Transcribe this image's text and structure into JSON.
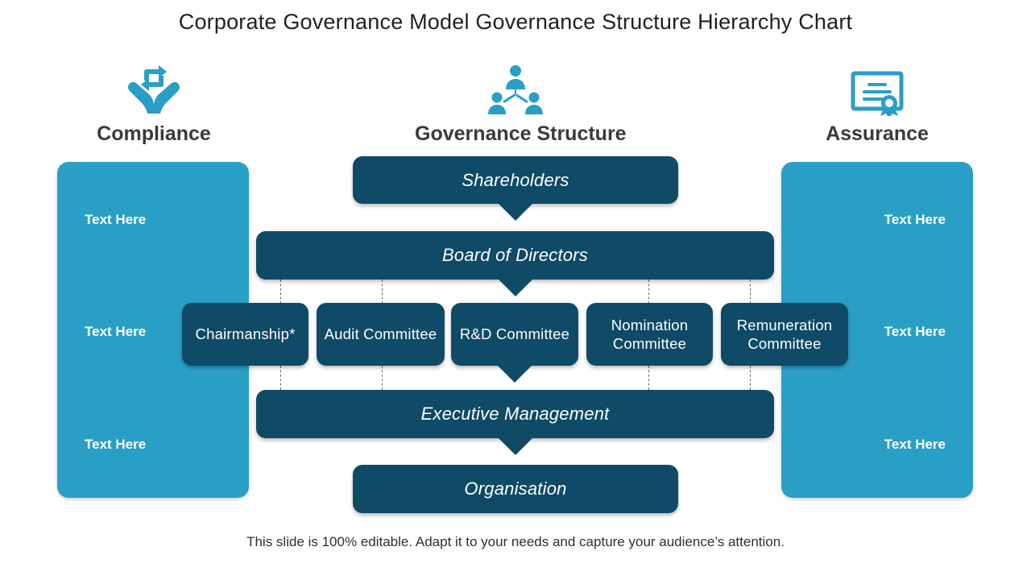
{
  "title": "Corporate Governance Model Governance Structure Hierarchy Chart",
  "footer": "This slide is 100% editable. Adapt it to your needs and capture your audience’s attention.",
  "colors": {
    "dark_box": "#0f4a66",
    "panel_blue": "#2a9fc6",
    "icon_blue": "#2a9fc6",
    "title_text": "#231f20",
    "heading_text": "#3a3a3a",
    "box_text": "#ffffff",
    "dash_line": "#6b6b6b",
    "background": "#ffffff"
  },
  "columns": {
    "left": {
      "label": "Compliance",
      "icon": "hands-holding-recycle-arrows-icon"
    },
    "center": {
      "label": "Governance Structure",
      "icon": "org-people-hierarchy-icon"
    },
    "right": {
      "label": "Assurance",
      "icon": "certificate-award-icon"
    }
  },
  "left_panel": {
    "name": "compliance-panel",
    "items": [
      "Text Here",
      "Text Here",
      "Text Here"
    ]
  },
  "right_panel": {
    "name": "assurance-panel",
    "items": [
      "Text Here",
      "Text Here",
      "Text Here"
    ]
  },
  "chart_data": {
    "type": "diagram",
    "title": "Governance Structure",
    "levels": [
      {
        "id": "shareholders",
        "label": "Shareholders",
        "rank": 1
      },
      {
        "id": "board",
        "label": "Board of Directors",
        "rank": 2
      },
      {
        "id": "committees",
        "label": "Committees",
        "rank": 3
      },
      {
        "id": "executive",
        "label": "Executive Management",
        "rank": 4
      },
      {
        "id": "organisation",
        "label": "Organisation",
        "rank": 5
      }
    ],
    "committees": [
      "Chairmanship*",
      "Audit Committee",
      "R&D Committee",
      "Nomination Committee",
      "Remuneration Committee"
    ],
    "edges": [
      {
        "from": "shareholders",
        "to": "board",
        "style": "arrow"
      },
      {
        "from": "board",
        "to": "committees",
        "style": "dashed"
      },
      {
        "from": "board",
        "to": "executive",
        "style": "arrow"
      },
      {
        "from": "committees",
        "to": "executive",
        "style": "dashed"
      },
      {
        "from": "executive",
        "to": "organisation",
        "style": "arrow"
      }
    ]
  },
  "flow": {
    "shareholders": "Shareholders",
    "board": "Board of Directors",
    "executive": "Executive Management",
    "organisation": "Organisation"
  }
}
